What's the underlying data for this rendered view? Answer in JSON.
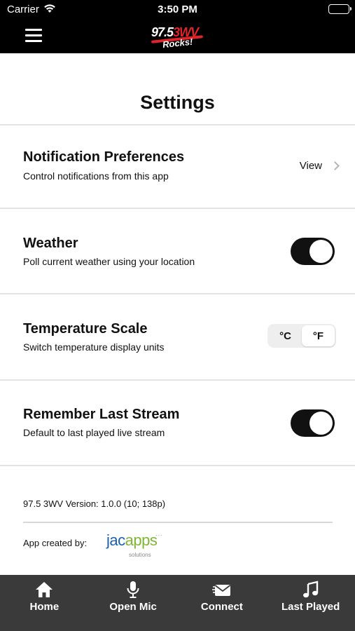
{
  "status_bar": {
    "carrier": "Carrier",
    "time": "3:50 PM",
    "icons": [
      "wifi-icon",
      "battery-icon"
    ]
  },
  "nav": {
    "menu_icon": "hamburger-menu-icon",
    "logo": {
      "main": "97.5",
      "accent": "3WV",
      "sub": "Rocks!"
    }
  },
  "page": {
    "title": "Settings"
  },
  "settings": {
    "notifications": {
      "title": "Notification Preferences",
      "subtitle": "Control notifications from this app",
      "action_label": "View"
    },
    "weather": {
      "title": "Weather",
      "subtitle": "Poll current weather using your location",
      "enabled": true
    },
    "temperature": {
      "title": "Temperature Scale",
      "subtitle": "Switch temperature display units",
      "options": [
        "°C",
        "°F"
      ],
      "selected": "°F"
    },
    "remember_stream": {
      "title": "Remember Last Stream",
      "subtitle": "Default to last played live stream",
      "enabled": true
    }
  },
  "footer": {
    "version": "97.5 3WV Version: 1.0.0 (10; 138p)",
    "created_by": "App created by:",
    "vendor_logo": {
      "main": "jac",
      "accent": "apps",
      "sub": "solutions"
    }
  },
  "tabs": [
    {
      "label": "Home",
      "icon": "home-icon"
    },
    {
      "label": "Open Mic",
      "icon": "microphone-icon"
    },
    {
      "label": "Connect",
      "icon": "envelope-icon"
    },
    {
      "label": "Last Played",
      "icon": "music-note-icon"
    }
  ],
  "colors": {
    "header_bg": "#000000",
    "tab_bar_bg": "#3a3a3a",
    "toggle_on": "#111111",
    "brand_red": "#e0232b",
    "vendor_blue": "#1a5fb0",
    "vendor_green": "#7fb534"
  }
}
